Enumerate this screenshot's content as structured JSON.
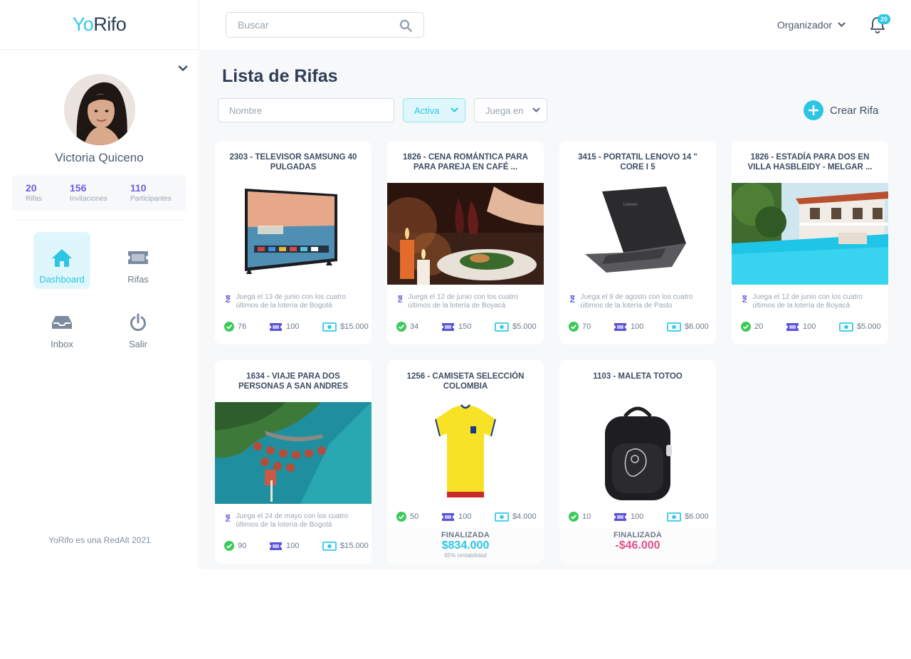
{
  "app": {
    "logo_yo": "Yo",
    "logo_rifo": "Rifo",
    "footer": "YoRifo es una RedAlt 2021"
  },
  "search": {
    "placeholder": "Buscar"
  },
  "header": {
    "role": "Organizador",
    "notifications": "20"
  },
  "profile": {
    "name": "Victoria Quiceno",
    "stats": [
      {
        "value": "20",
        "label": "Rifas"
      },
      {
        "value": "156",
        "label": "Invitaciones"
      },
      {
        "value": "110",
        "label": "Participantes"
      }
    ]
  },
  "nav": [
    {
      "label": "Dashboard",
      "icon": "home-icon",
      "active": true
    },
    {
      "label": "Rifas",
      "icon": "ticket-icon"
    },
    {
      "label": "Inbox",
      "icon": "inbox-icon"
    },
    {
      "label": "Salir",
      "icon": "power-icon"
    }
  ],
  "page": {
    "title": "Lista de Rifas",
    "filter_name_placeholder": "Nombre",
    "filter_status": "Activa",
    "filter_plays": "Juega en",
    "create_label": "Crear Rifa"
  },
  "colors": {
    "accent": "#2cc5e3",
    "purple": "#6b5fe0",
    "green": "#3cc95a",
    "negative": "#e0528a",
    "dark": "#2f3e56"
  },
  "raffles": [
    {
      "title": "2303 - TELEVISOR SAMSUNG 40 PULGADAS",
      "image": "tv-image",
      "play": "Juega el 13 de junio con los cuatro últimos de la lotería de Bogotá",
      "sold": "76",
      "tickets": "100",
      "price": "$15.000"
    },
    {
      "title": "1826 - CENA ROMÁNTICA PARA PARA PAREJA EN CAFÉ ...",
      "image": "dinner-image",
      "play": "Juega el 12 de junio con los cuatro últimos de la lotería de Boyacá",
      "sold": "34",
      "tickets": "150",
      "price": "$5.000"
    },
    {
      "title": "3415 - PORTATIL LENOVO 14 \" CORE I 5",
      "image": "laptop-image",
      "play": "Juega el 9 de agosto con los cuatro últimos de la lotería de Pasto",
      "sold": "70",
      "tickets": "100",
      "price": "$6.000"
    },
    {
      "title": "1826 - ESTADÍA PARA DOS EN VILLA HASBLEIDY - MELGAR ...",
      "image": "villa-image",
      "play": "Juega el 12 de junio con los cuatro últimos de la lotería de Boyacá",
      "sold": "20",
      "tickets": "100",
      "price": "$5.000"
    },
    {
      "title": "1634 - VIAJE PARA DOS PERSONAS A SAN ANDRES",
      "image": "island-image",
      "play": "Juega el 24 de mayo con los cuatro últimos de la lotería de Bogotá",
      "sold": "90",
      "tickets": "100",
      "price": "$15.000"
    },
    {
      "title": "1256 - CAMISETA SELECCIÓN COLOMBIA",
      "image": "jersey-image",
      "sold": "50",
      "tickets": "100",
      "price": "$4.000",
      "state": "FINALIZADA",
      "result": "$834.000",
      "result_note": "65% rentabilidad"
    },
    {
      "title": "1103 - MALETA TOTOO",
      "image": "backpack-image",
      "sold": "10",
      "tickets": "100",
      "price": "$6.000",
      "state": "FINALIZADA",
      "result": "-$46.000"
    }
  ]
}
